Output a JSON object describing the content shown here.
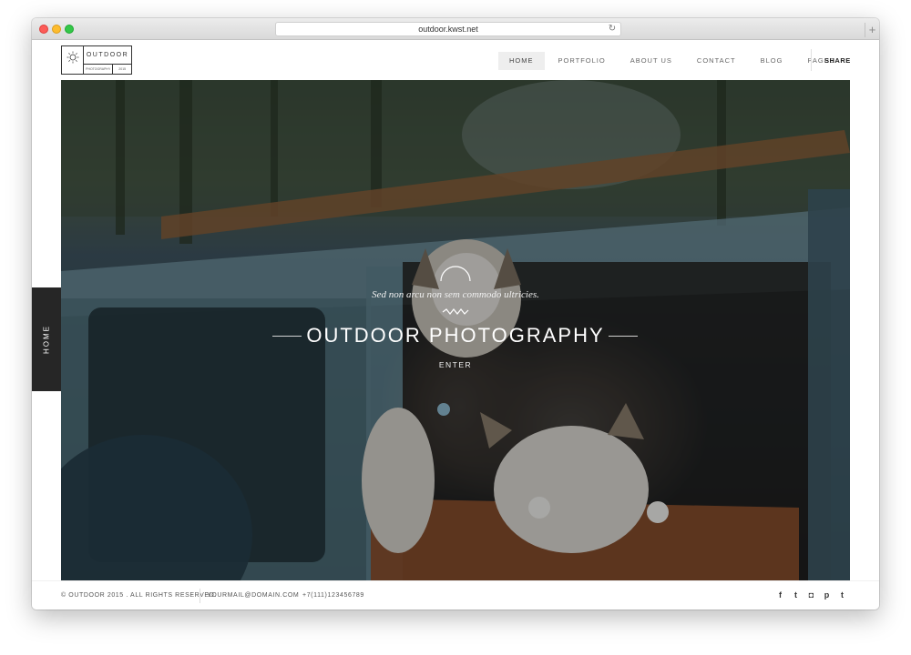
{
  "browser": {
    "url": "outdoor.kwst.net",
    "new_tab_symbol": "+"
  },
  "logo": {
    "name": "OUTDOOR",
    "tiny_text": "",
    "sub_left": "PHOTOGRAPHY",
    "sub_right": "2015"
  },
  "nav": {
    "items": [
      "HOME",
      "PORTFOLIO",
      "ABOUT US",
      "CONTACT",
      "BLOG",
      "PAGES"
    ],
    "active_index": 0,
    "share_label": "SHARE"
  },
  "hero": {
    "tagline": "Sed non arcu non sem commodo ultricies.",
    "title": "OUTDOOR PHOTOGRAPHY",
    "enter_label": "ENTER",
    "side_tab_label": "HOME"
  },
  "footer": {
    "copyright": "© OUTDOOR 2015 . ALL RIGHTS RESERVED.",
    "email": "YOURMAIL@DOMAIN.COM",
    "phone": "+7(111)123456789",
    "socials": [
      {
        "icon": "facebook-icon",
        "glyph": "f"
      },
      {
        "icon": "twitter-icon",
        "glyph": "t"
      },
      {
        "icon": "instagram-icon",
        "glyph": "◘"
      },
      {
        "icon": "pinterest-icon",
        "glyph": "p"
      },
      {
        "icon": "tumblr-icon",
        "glyph": "t"
      }
    ]
  },
  "colors": {
    "side_tab": "#262626",
    "nav_active_bg": "#eeeeee",
    "text_dark": "#333333"
  }
}
